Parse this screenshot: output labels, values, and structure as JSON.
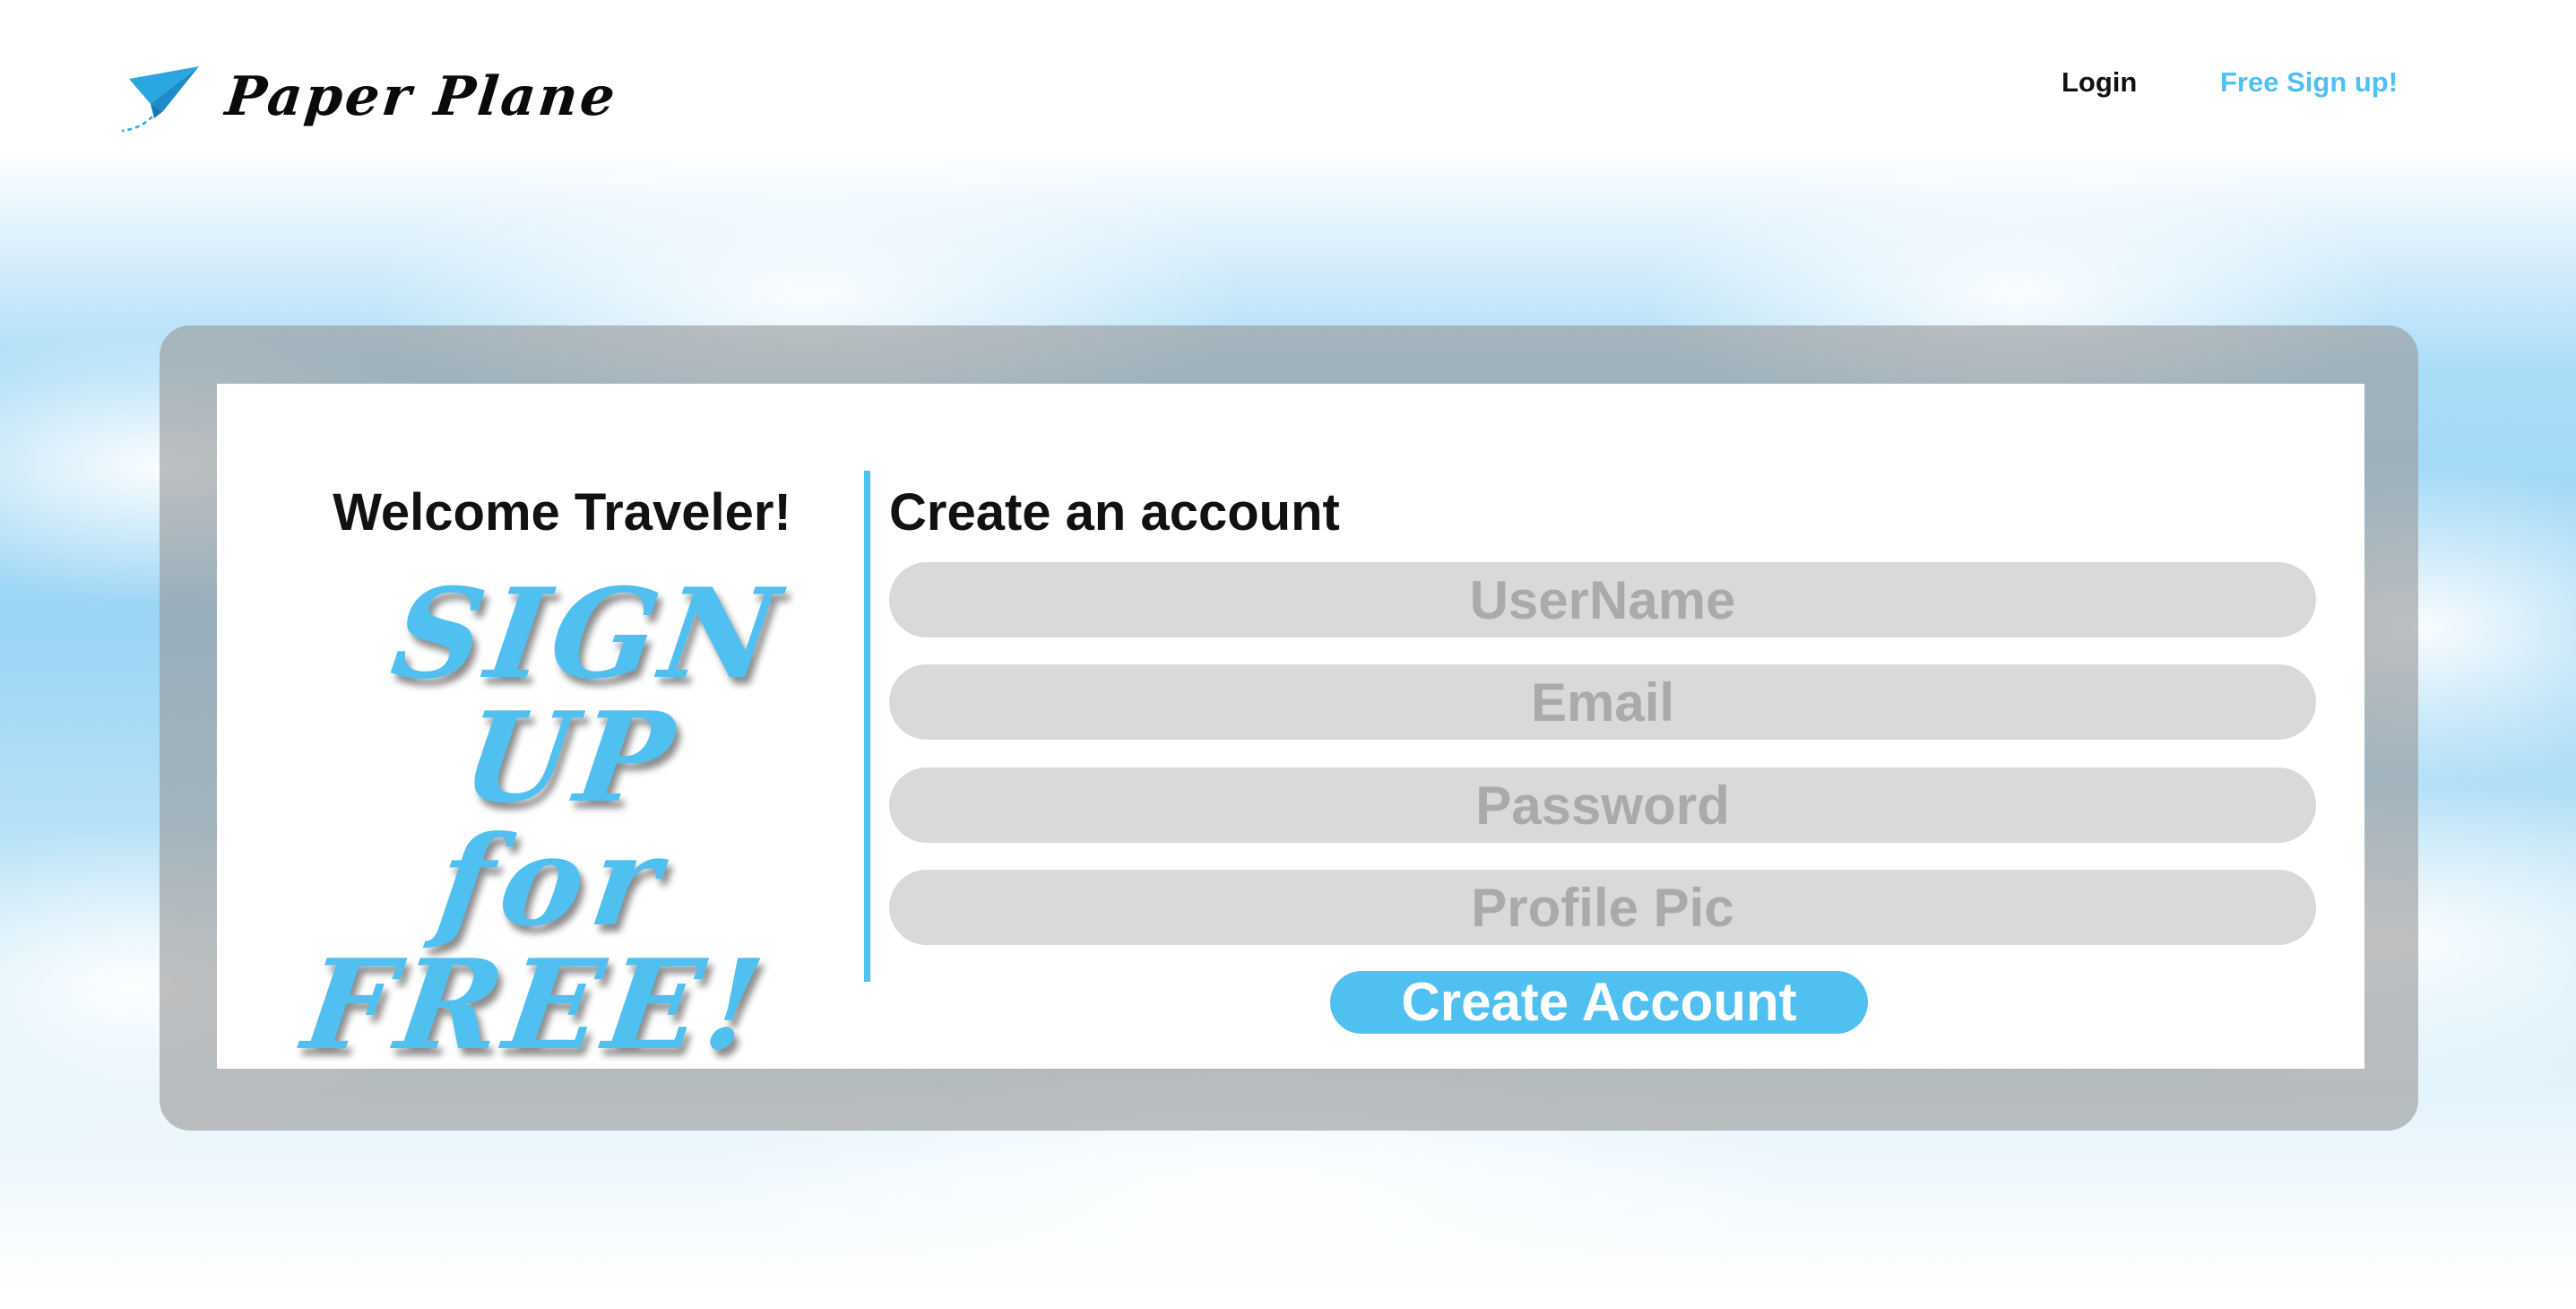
{
  "brand": {
    "name": "Paper Plane",
    "icon": "paper-plane-icon",
    "accent": "#4fc0ef"
  },
  "nav": {
    "login_label": "Login",
    "signup_label": "Free Sign up!"
  },
  "left_panel": {
    "welcome": "Welcome Traveler!",
    "promo_lines": [
      "SIGN UP",
      "for",
      "FREE!"
    ]
  },
  "form": {
    "title": "Create an account",
    "fields": {
      "username_placeholder": "UserName",
      "email_placeholder": "Email",
      "password_placeholder": "Password",
      "profile_pic_placeholder": "Profile Pic"
    },
    "submit_label": "Create Account"
  }
}
